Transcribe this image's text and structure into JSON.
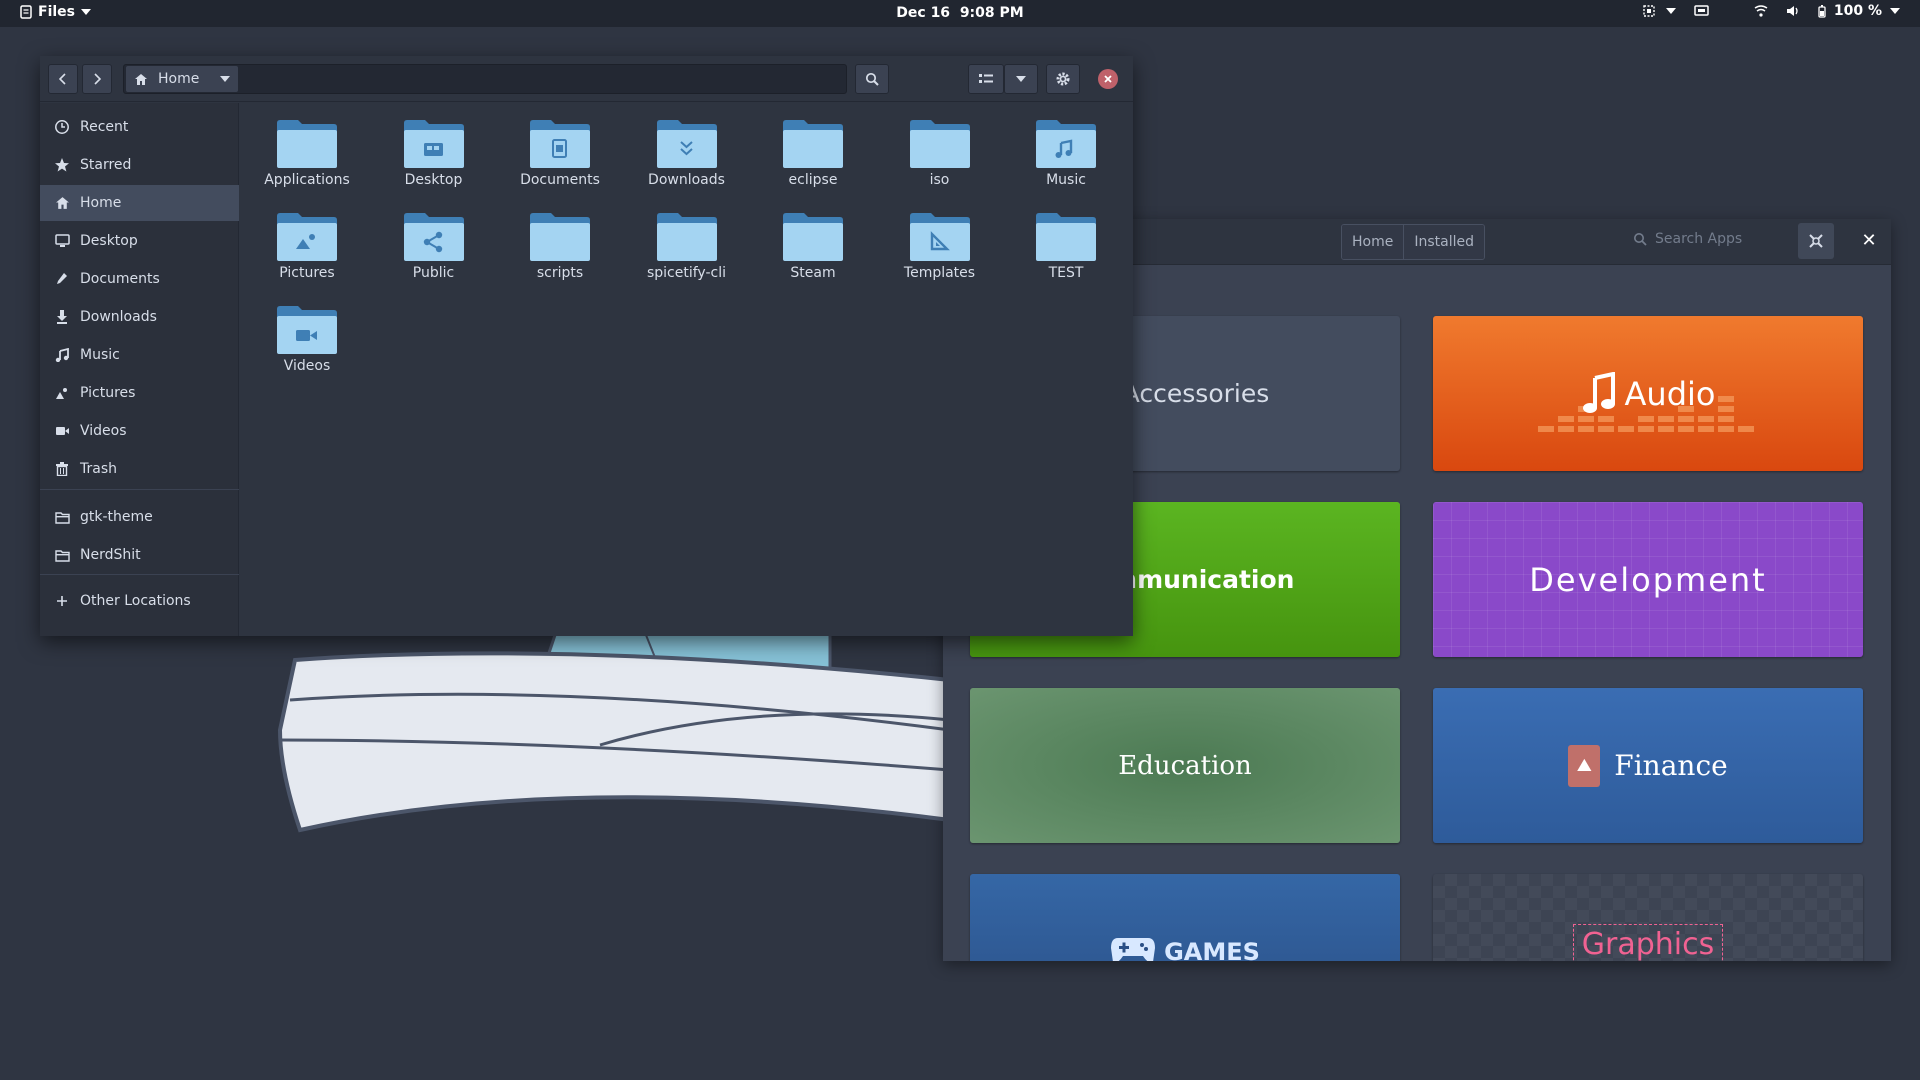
{
  "topbar": {
    "app_name": "Files",
    "date": "Dec 16",
    "time": "9:08 PM",
    "battery": "100 %"
  },
  "files_window": {
    "path": "Home",
    "sidebar": [
      {
        "label": "Recent",
        "icon": "clock-icon"
      },
      {
        "label": "Starred",
        "icon": "star-icon"
      },
      {
        "label": "Home",
        "icon": "home-icon",
        "active": true
      },
      {
        "label": "Desktop",
        "icon": "desktop-icon"
      },
      {
        "label": "Documents",
        "icon": "documents-icon"
      },
      {
        "label": "Downloads",
        "icon": "download-icon"
      },
      {
        "label": "Music",
        "icon": "music-icon"
      },
      {
        "label": "Pictures",
        "icon": "pictures-icon"
      },
      {
        "label": "Videos",
        "icon": "videos-icon"
      },
      {
        "label": "Trash",
        "icon": "trash-icon"
      }
    ],
    "bookmarks": [
      {
        "label": "gtk-theme",
        "icon": "folder-icon"
      },
      {
        "label": "NerdShit",
        "icon": "folder-icon"
      }
    ],
    "other_locations": "Other Locations",
    "folders": [
      {
        "name": "Applications",
        "emblem": "none"
      },
      {
        "name": "Desktop",
        "emblem": "desktop"
      },
      {
        "name": "Documents",
        "emblem": "document"
      },
      {
        "name": "Downloads",
        "emblem": "download"
      },
      {
        "name": "eclipse",
        "emblem": "none"
      },
      {
        "name": "iso",
        "emblem": "none"
      },
      {
        "name": "Music",
        "emblem": "music"
      },
      {
        "name": "Pictures",
        "emblem": "picture"
      },
      {
        "name": "Public",
        "emblem": "share"
      },
      {
        "name": "scripts",
        "emblem": "none"
      },
      {
        "name": "spicetify-cli",
        "emblem": "none"
      },
      {
        "name": "Steam",
        "emblem": "none"
      },
      {
        "name": "Templates",
        "emblem": "template"
      },
      {
        "name": "TEST",
        "emblem": "none"
      },
      {
        "name": "Videos",
        "emblem": "video"
      }
    ]
  },
  "app_center": {
    "tabs": [
      "Home",
      "Installed"
    ],
    "search_placeholder": "Search Apps",
    "categories": [
      {
        "label": "Accessories",
        "color": "#434c5e"
      },
      {
        "label": "Audio",
        "color": "#e7561a"
      },
      {
        "label": "Communication",
        "color": "#53a51b"
      },
      {
        "label": "Development",
        "color": "#8a49c9"
      },
      {
        "label": "Education",
        "color": "#5b8562"
      },
      {
        "label": "Finance",
        "color": "#3566a8"
      },
      {
        "label": "GAMES",
        "color": "#2f578f"
      },
      {
        "label": "Graphics",
        "color": "#3d4453"
      }
    ]
  },
  "colors": {
    "folder_light": "#a4d4f2",
    "folder_dark": "#3f7fb5",
    "close_button": "#bf616a"
  }
}
